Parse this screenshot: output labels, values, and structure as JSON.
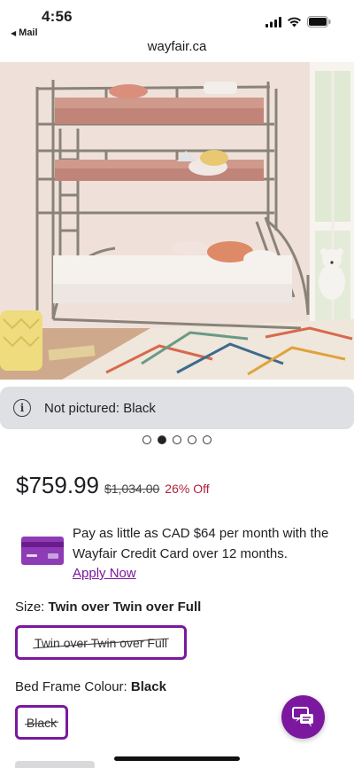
{
  "status_bar": {
    "time": "4:56",
    "back_app": "Mail",
    "icons": [
      "cellular-signal-icon",
      "wifi-icon",
      "battery-icon"
    ]
  },
  "browser": {
    "domain": "wayfair.ca"
  },
  "product_image": {
    "alt_subject": "triple bunk bed"
  },
  "notice": {
    "icon": "info-icon",
    "text": "Not pictured: Black"
  },
  "carousel": {
    "count": 5,
    "active_index": 1
  },
  "price": {
    "current": "$759.99",
    "original": "$1,034.00",
    "discount": "26% Off"
  },
  "promo": {
    "icon": "credit-card-icon",
    "text": "Pay as little as CAD $64 per month with the Wayfair Credit Card over 12 months.",
    "link": "Apply Now"
  },
  "size": {
    "label": "Size: ",
    "selected": "Twin over Twin over Full",
    "option": "Twin over Twin over Full"
  },
  "colour": {
    "label": "Bed Frame Colour: ",
    "selected": "Black",
    "option": "Black"
  },
  "chat": {
    "icon": "chat-bubbles-icon"
  },
  "colors": {
    "brand_purple": "#7b189f",
    "discount_red": "#b2223b",
    "notice_bg": "#dfe0e3"
  }
}
